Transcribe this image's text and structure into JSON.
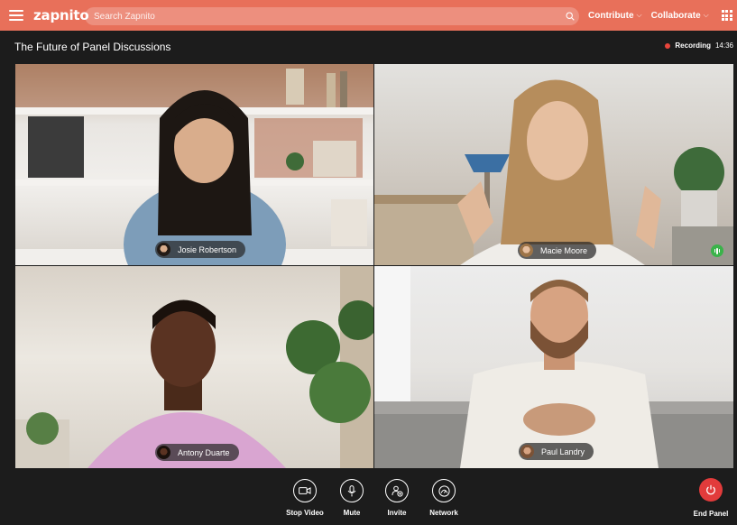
{
  "app": {
    "logo": "zapnito"
  },
  "search": {
    "placeholder": "Search Zapnito"
  },
  "nav": {
    "contribute": "Contribute",
    "collaborate": "Collaborate"
  },
  "session": {
    "title": "The Future of Panel Discussions",
    "recording_label": "Recording",
    "elapsed": "14:36"
  },
  "participants": [
    {
      "name": "Josie Robertson"
    },
    {
      "name": "Macie Moore",
      "speaking": true
    },
    {
      "name": "Antony Duarte"
    },
    {
      "name": "Paul Landry"
    }
  ],
  "controls": {
    "stop_video": "Stop Video",
    "mute": "Mute",
    "invite": "Invite",
    "network": "Network",
    "end_panel": "End Panel"
  },
  "colors": {
    "brand": "#e8705a",
    "background": "#1c1c1c",
    "recording": "#e8453c",
    "speaking": "#3ab34a",
    "end": "#e23b3b"
  }
}
